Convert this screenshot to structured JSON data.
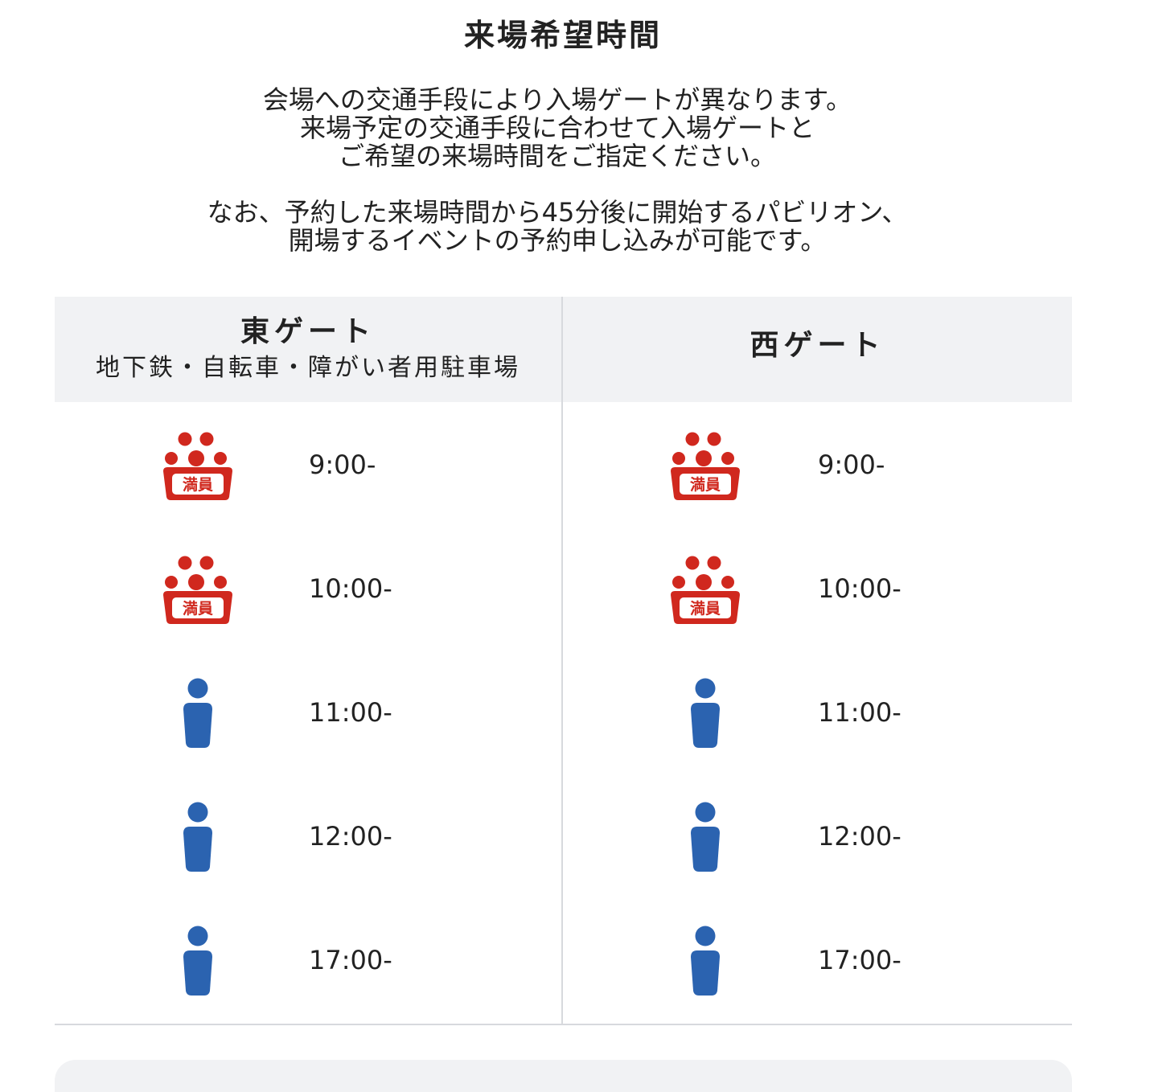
{
  "page": {
    "title": "来場希望時間",
    "intro_1": [
      "会場への交通手段により入場ゲートが異なります。",
      "来場予定の交通手段に合わせて入場ゲートと",
      "ご希望の来場時間をご指定ください。"
    ],
    "intro_2": [
      "なお、予約した来場時間から45分後に開始するパビリオン、",
      "開場するイベントの予約申し込みが可能です。"
    ]
  },
  "colors": {
    "full": "#d0281e",
    "available": "#2b63b0",
    "header_bg": "#f1f2f4",
    "border": "#d7d9dd"
  },
  "gates": [
    {
      "name": "東ゲート",
      "subtitle": "地下鉄・自転車・障がい者用駐車場",
      "slots": [
        {
          "time": "9:00-",
          "status": "full",
          "icon": "full-crowd-icon",
          "badge": "満員"
        },
        {
          "time": "10:00-",
          "status": "full",
          "icon": "full-crowd-icon",
          "badge": "満員"
        },
        {
          "time": "11:00-",
          "status": "available",
          "icon": "person-icon"
        },
        {
          "time": "12:00-",
          "status": "available",
          "icon": "person-icon"
        },
        {
          "time": "17:00-",
          "status": "available",
          "icon": "person-icon"
        }
      ]
    },
    {
      "name": "西ゲート",
      "subtitle": "",
      "slots": [
        {
          "time": "9:00-",
          "status": "full",
          "icon": "full-crowd-icon",
          "badge": "満員"
        },
        {
          "time": "10:00-",
          "status": "full",
          "icon": "full-crowd-icon",
          "badge": "満員"
        },
        {
          "time": "11:00-",
          "status": "available",
          "icon": "person-icon"
        },
        {
          "time": "12:00-",
          "status": "available",
          "icon": "person-icon"
        },
        {
          "time": "17:00-",
          "status": "available",
          "icon": "person-icon"
        }
      ]
    }
  ]
}
